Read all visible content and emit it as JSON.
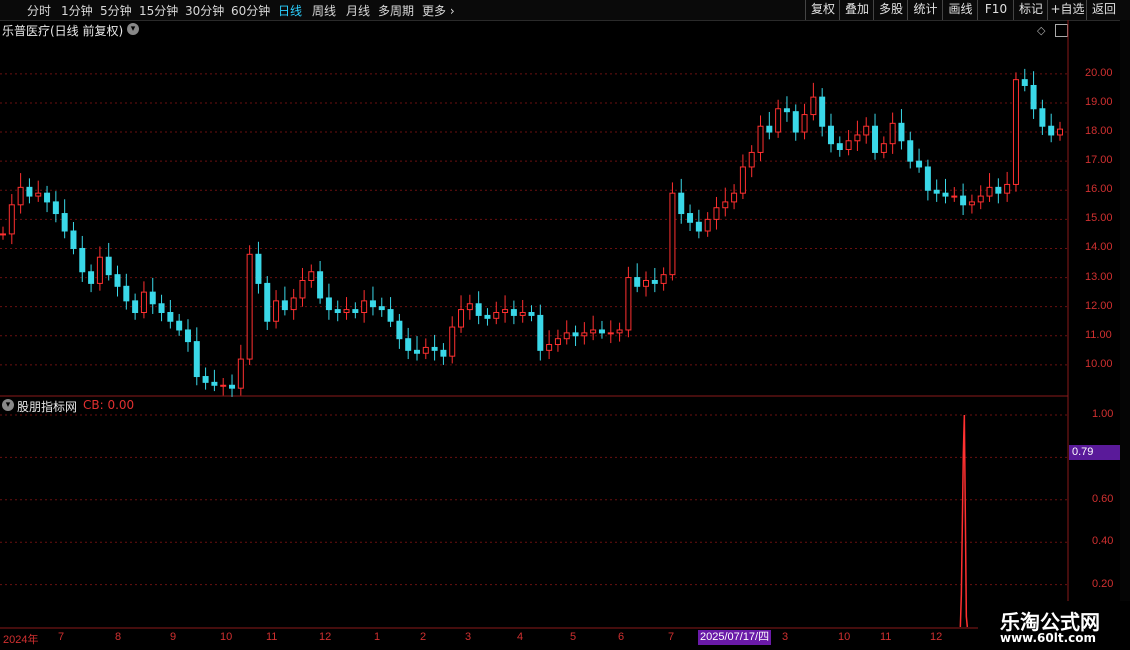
{
  "toolbar": {
    "periods": [
      "分时",
      "1分钟",
      "5分钟",
      "15分钟",
      "30分钟",
      "60分钟",
      "日线",
      "周线",
      "月线",
      "多周期",
      "更多"
    ],
    "active_period": "日线",
    "right_buttons": [
      "复权",
      "叠加",
      "多股",
      "统计",
      "画线",
      "F10",
      "标记",
      "+自选",
      "返回"
    ]
  },
  "main_chart": {
    "title": "乐普医疗(日线 前复权)",
    "y_ticks": [
      "20.00",
      "19.00",
      "18.00",
      "17.00",
      "16.00",
      "15.00",
      "14.00",
      "13.00",
      "12.00",
      "11.00",
      "10.00"
    ]
  },
  "indicator": {
    "title": "股朋指标网",
    "cb_text": "CB: 0.00",
    "y_ticks": [
      "1.00",
      "0.80",
      "0.60",
      "0.40",
      "0.20"
    ],
    "cursor_value": "0.79"
  },
  "x_axis": {
    "labels": [
      "2024年",
      "7",
      "8",
      "9",
      "10",
      "11",
      "12",
      "1",
      "2",
      "3",
      "4",
      "5",
      "6",
      "7",
      "3",
      "10",
      "11",
      "12"
    ],
    "cursor_date": "2025/07/17/四"
  },
  "watermark": {
    "name": "乐淘公式网",
    "url": "www.60lt.com"
  },
  "colors": {
    "up": "#ff3030",
    "down": "#3ad8e8",
    "grid": "#6a1010",
    "axis": "#d03030",
    "active": "#2bd0ff"
  },
  "chart_data": {
    "type": "candlestick",
    "ylim": [
      9.0,
      21.3
    ],
    "closes": [
      14.5,
      15.5,
      16.1,
      15.8,
      15.9,
      15.6,
      15.2,
      14.6,
      14.0,
      13.2,
      12.8,
      13.7,
      13.1,
      12.7,
      12.2,
      11.8,
      12.5,
      12.1,
      11.8,
      11.5,
      11.2,
      10.8,
      9.6,
      9.4,
      9.3,
      9.3,
      9.2,
      10.2,
      13.8,
      12.8,
      11.5,
      12.2,
      11.9,
      12.3,
      12.9,
      13.2,
      12.3,
      11.9,
      11.8,
      11.9,
      11.8,
      12.2,
      12.0,
      11.9,
      11.5,
      10.9,
      10.5,
      10.4,
      10.6,
      10.5,
      10.3,
      11.3,
      11.9,
      12.1,
      11.7,
      11.6,
      11.8,
      11.9,
      11.7,
      11.8,
      11.7,
      10.5,
      10.7,
      10.9,
      11.1,
      11.0,
      11.1,
      11.2,
      11.1,
      11.1,
      11.2,
      13.0,
      12.7,
      12.9,
      12.8,
      13.1,
      15.9,
      15.2,
      14.9,
      14.6,
      15.0,
      15.4,
      15.6,
      15.9,
      16.8,
      17.3,
      18.2,
      18.0,
      18.8,
      18.7,
      18.0,
      18.6,
      19.2,
      18.2,
      17.6,
      17.4,
      17.7,
      17.9,
      18.2,
      17.3,
      17.6,
      18.3,
      17.7,
      17.0,
      16.8,
      16.0,
      15.9,
      15.8,
      15.8,
      15.5,
      15.6,
      15.8,
      16.1,
      15.9,
      16.2,
      19.8,
      19.6,
      18.8,
      18.2,
      17.9,
      18.1
    ],
    "indicator_spike": {
      "x_fraction": 0.902,
      "peak": 1.0,
      "width": 2
    }
  }
}
